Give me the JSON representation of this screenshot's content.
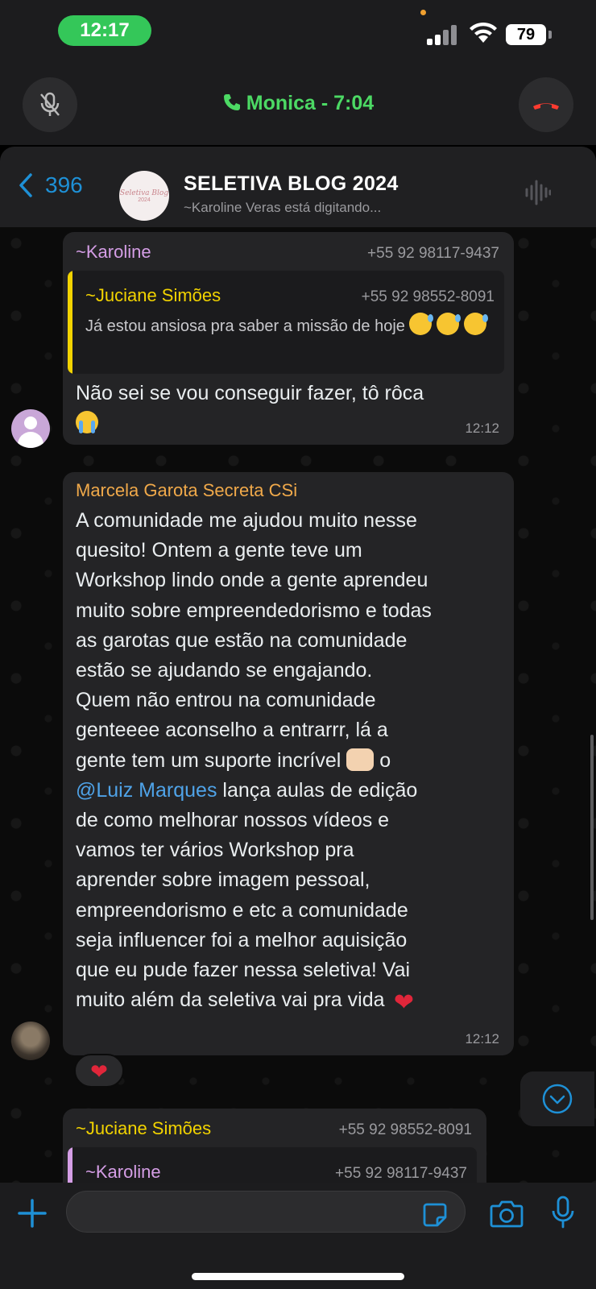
{
  "status": {
    "time": "12:17",
    "battery": "79"
  },
  "call": {
    "name": "Monica",
    "duration": "  - 7:04"
  },
  "header": {
    "back_count": "396",
    "title": "SELETIVA BLOG 2024",
    "subtitle": "~Karoline Veras está digitando...",
    "avatar_text_1": "Seletiva Blog",
    "avatar_text_2": "2024"
  },
  "messages": [
    {
      "sender": "~Karoline",
      "sender_color": "#d59ee6",
      "phone": "+55 92 98117-9437",
      "quote": {
        "sender": "~Juciane Simões",
        "sender_color": "#f2d300",
        "phone": "+55 92 98552-8091",
        "text": "Já estou ansiosa pra saber a missão de hoje"
      },
      "text": "Não sei se vou conseguir fazer, tô rôca",
      "time": "12:12"
    },
    {
      "sender": "Marcela Garota Secreta CSi",
      "sender_color": "#f0a94a",
      "lines": [
        "A comunidade me ajudou muito nesse",
        "quesito! Ontem a gente teve um",
        "Workshop lindo onde a gente aprendeu",
        "muito sobre empreendedorismo e todas",
        "as garotas que  estão na comunidade",
        "estão se ajudando se engajando.",
        "Quem não entrou na comunidade",
        "genteeee aconselho a entrarrr, lá a",
        "gente tem um suporte incrível",
        "o",
        "@Luiz Marques",
        "lança aulas de edição",
        "de como melhorar nossos vídeos e",
        "vamos ter vários Workshop pra",
        "aprender sobre imagem pessoal,",
        "empreendorismo e etc a comunidade",
        "seja influencer  foi a melhor aquisição",
        "que eu pude fazer nessa seletiva! Vai",
        "muito além da seletiva vai pra vida"
      ],
      "time": "12:12",
      "reaction": "❤"
    },
    {
      "sender": "~Juciane Simões",
      "sender_color": "#f2d300",
      "phone": "+55 92 98552-8091",
      "quote": {
        "sender": "~Karoline",
        "sender_color": "#d59ee6",
        "phone": "+55 92 98117-9437"
      }
    }
  ],
  "input": {
    "placeholder": ""
  },
  "colors": {
    "accent_blue": "#1e90d6",
    "call_green": "#4cd964",
    "end_call_red": "#ff3b30"
  }
}
